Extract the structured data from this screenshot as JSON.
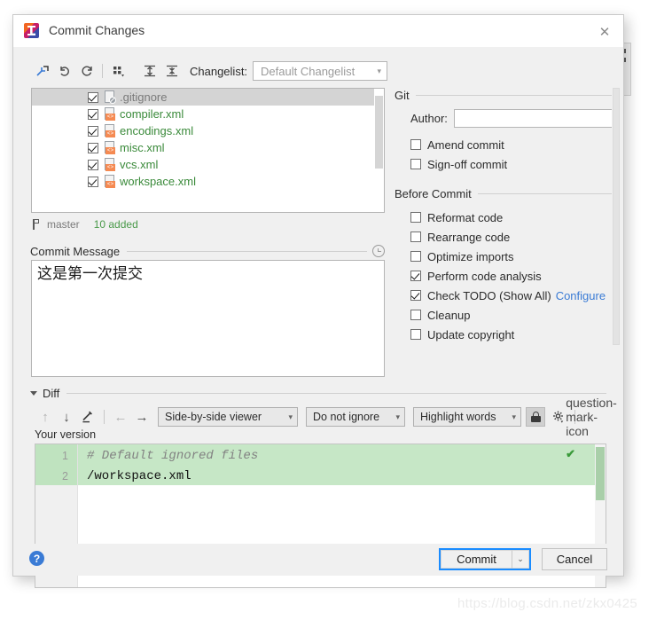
{
  "window": {
    "title": "Commit Changes",
    "app_icon": "intellij-idea-icon",
    "close_label": "✕"
  },
  "toolbar": {
    "buttons": [
      {
        "name": "collapse-selection-icon",
        "glyph": "collapse"
      },
      {
        "name": "rollback-icon",
        "glyph": "undo"
      },
      {
        "name": "refresh-icon",
        "glyph": "refresh"
      },
      {
        "name": "group-by-icon",
        "glyph": "groupby"
      },
      {
        "name": "expand-all-icon",
        "glyph": "expand"
      },
      {
        "name": "collapse-all-icon",
        "glyph": "collapseall"
      }
    ],
    "changelist_label": "Changelist:",
    "changelist_label_mnemonic": "t",
    "changelist_value": "Default Changelist"
  },
  "file_list": {
    "files": [
      {
        "name": ".gitignore",
        "checked": true,
        "selected": true,
        "icon": "ignore-file-icon",
        "kind": "ignore"
      },
      {
        "name": "compiler.xml",
        "checked": true,
        "selected": false,
        "icon": "xml-file-icon",
        "kind": "xml"
      },
      {
        "name": "encodings.xml",
        "checked": true,
        "selected": false,
        "icon": "xml-file-icon",
        "kind": "xml"
      },
      {
        "name": "misc.xml",
        "checked": true,
        "selected": false,
        "icon": "xml-file-icon",
        "kind": "xml"
      },
      {
        "name": "vcs.xml",
        "checked": true,
        "selected": false,
        "icon": "xml-file-icon",
        "kind": "xml"
      },
      {
        "name": "workspace.xml",
        "checked": true,
        "selected": false,
        "icon": "xml-file-icon",
        "kind": "xml"
      }
    ]
  },
  "status": {
    "branch_icon": "git-branch-icon",
    "branch": "master",
    "added": "10 added"
  },
  "commit_message": {
    "title": "Commit Message",
    "title_mnemonic": "C",
    "history_icon": "history-clock-icon",
    "text": "这是第一次提交"
  },
  "git_section": {
    "title": "Git",
    "author_label": "Author:",
    "author_mnemonic": "A",
    "author_value": "",
    "options": [
      {
        "label": "Amend commit",
        "checked": false,
        "mnemonic": "m"
      },
      {
        "label": "Sign-off commit",
        "checked": false,
        "mnemonic": "n"
      }
    ]
  },
  "before_commit": {
    "title": "Before Commit",
    "options": [
      {
        "label": "Reformat code",
        "checked": false,
        "mnemonic": "R",
        "link": ""
      },
      {
        "label": "Rearrange code",
        "checked": false,
        "mnemonic": "n",
        "link": ""
      },
      {
        "label": "Optimize imports",
        "checked": false,
        "mnemonic": "O",
        "link": ""
      },
      {
        "label": "Perform code analysis",
        "checked": true,
        "mnemonic": "",
        "link": ""
      },
      {
        "label": "Check TODO (Show All)",
        "checked": true,
        "mnemonic": "",
        "link": "Configure"
      },
      {
        "label": "Cleanup",
        "checked": false,
        "mnemonic": "l",
        "link": ""
      },
      {
        "label": "Update copyright",
        "checked": false,
        "mnemonic": "",
        "link": ""
      }
    ]
  },
  "diff": {
    "section_title": "Diff",
    "expanded": true,
    "buttons": [
      {
        "name": "previous-difference-icon",
        "glyph": "↑",
        "dim": true
      },
      {
        "name": "next-difference-icon",
        "glyph": "↓",
        "dim": false
      },
      {
        "name": "edit-source-icon",
        "glyph": "pencil",
        "dim": false
      },
      {
        "name": "accept-left-icon",
        "glyph": "←",
        "dim": true
      },
      {
        "name": "accept-right-icon",
        "glyph": "→",
        "dim": false
      }
    ],
    "viewer_mode": "Side-by-side viewer",
    "whitespace_mode": "Do not ignore",
    "highlight_mode": "Highlight words",
    "lock_icon": "read-only-lock-icon",
    "settings_icon": "gear-icon",
    "help_icon": "question-mark-icon",
    "pane_label": "Your version",
    "lines": [
      {
        "num": "1",
        "text": "# Default ignored files",
        "style": "comment"
      },
      {
        "num": "2",
        "text": "/workspace.xml",
        "style": "plain"
      }
    ],
    "ok_marker": "✔"
  },
  "footer": {
    "help_icon": "help-icon",
    "help_glyph": "?",
    "commit_label": "Commit",
    "commit_mnemonic": "i",
    "commit_dropdown_glyph": "⌄",
    "cancel_label": "Cancel"
  },
  "watermark": "https://blog.csdn.net/zkx0425",
  "colors": {
    "accent_blue": "#1a8cff",
    "link_blue": "#3a7bd5",
    "added_green": "#4a9a4a",
    "diff_band_green": "#c6e7c6",
    "file_green": "#3a8a3a",
    "xml_tag_orange": "#f58a52"
  }
}
